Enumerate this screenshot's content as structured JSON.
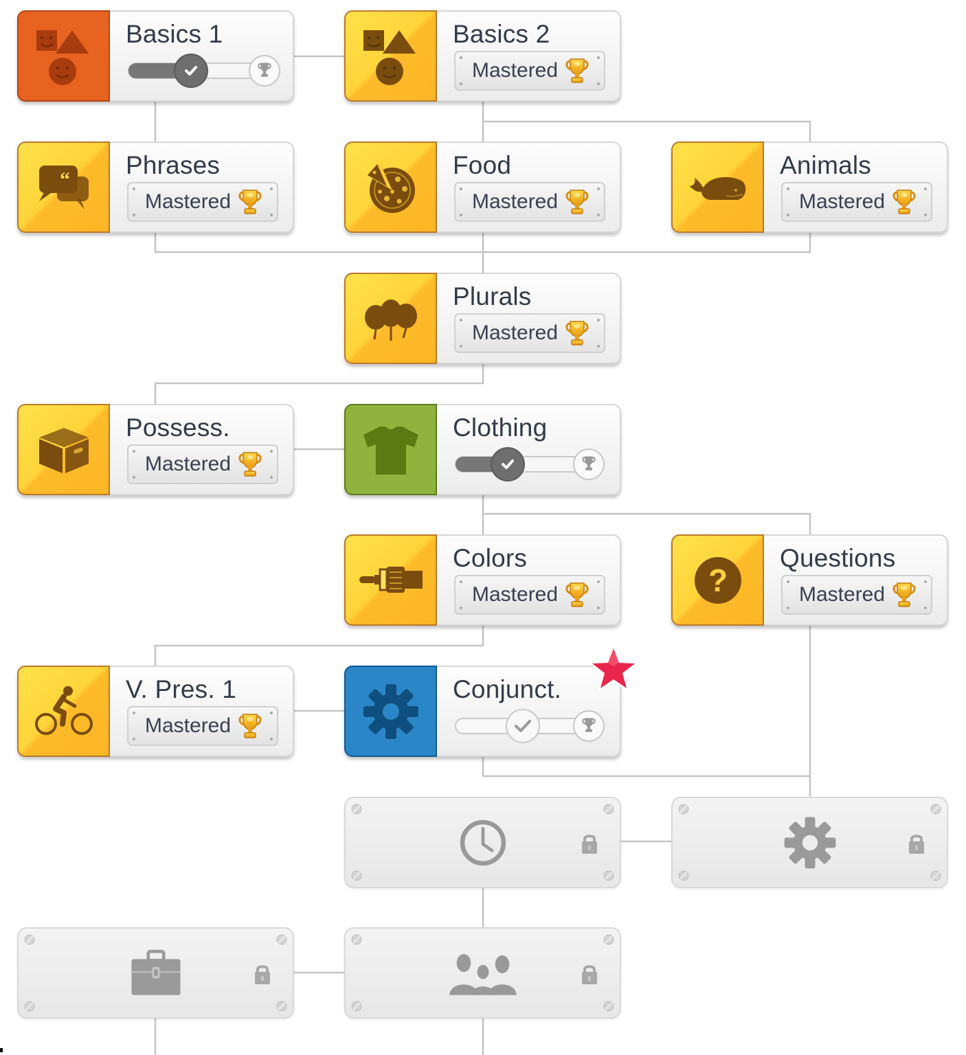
{
  "skill_tree": {
    "skills": [
      {
        "id": "basics-1",
        "name": "Basics 1",
        "icon": "shapes-faces-icon",
        "color": "orange",
        "status": "in-progress",
        "progress": 0.5
      },
      {
        "id": "basics-2",
        "name": "Basics 2",
        "icon": "shapes-faces-icon",
        "color": "gold",
        "status": "mastered",
        "badge_label": "Mastered"
      },
      {
        "id": "phrases",
        "name": "Phrases",
        "icon": "speech-bubbles-icon",
        "color": "gold",
        "status": "mastered",
        "badge_label": "Mastered"
      },
      {
        "id": "food",
        "name": "Food",
        "icon": "pizza-icon",
        "color": "gold",
        "status": "mastered",
        "badge_label": "Mastered"
      },
      {
        "id": "animals",
        "name": "Animals",
        "icon": "whale-icon",
        "color": "gold",
        "status": "mastered",
        "badge_label": "Mastered"
      },
      {
        "id": "plurals",
        "name": "Plurals",
        "icon": "balloons-icon",
        "color": "gold",
        "status": "mastered",
        "badge_label": "Mastered"
      },
      {
        "id": "possessives",
        "name": "Possess.",
        "icon": "box-icon",
        "color": "gold",
        "status": "mastered",
        "badge_label": "Mastered"
      },
      {
        "id": "clothing",
        "name": "Clothing",
        "icon": "tshirt-icon",
        "color": "green",
        "status": "in-progress",
        "progress": 0.5
      },
      {
        "id": "colors",
        "name": "Colors",
        "icon": "paintbrush-icon",
        "color": "gold",
        "status": "mastered",
        "badge_label": "Mastered"
      },
      {
        "id": "questions",
        "name": "Questions",
        "icon": "question-mark-icon",
        "color": "gold",
        "status": "mastered",
        "badge_label": "Mastered"
      },
      {
        "id": "verbs-present-1",
        "name": "V. Pres. 1",
        "icon": "cyclist-icon",
        "color": "gold",
        "status": "mastered",
        "badge_label": "Mastered"
      },
      {
        "id": "conjunctions",
        "name": "Conjunct.",
        "icon": "gear-icon",
        "color": "blue",
        "status": "new",
        "progress": 0,
        "new_marker": "star-icon"
      }
    ],
    "locked_skills": [
      {
        "id": "locked-time",
        "icon": "clock-icon"
      },
      {
        "id": "locked-gear",
        "icon": "gear-icon"
      },
      {
        "id": "locked-occupation",
        "icon": "briefcase-icon"
      },
      {
        "id": "locked-family",
        "icon": "people-icon"
      }
    ],
    "colors": {
      "gold": "#fdc12e",
      "orange": "#e8631f",
      "green": "#8fb33c",
      "blue": "#2b86c7",
      "star": "#e8264c",
      "connector": "#c4c4c4"
    }
  }
}
